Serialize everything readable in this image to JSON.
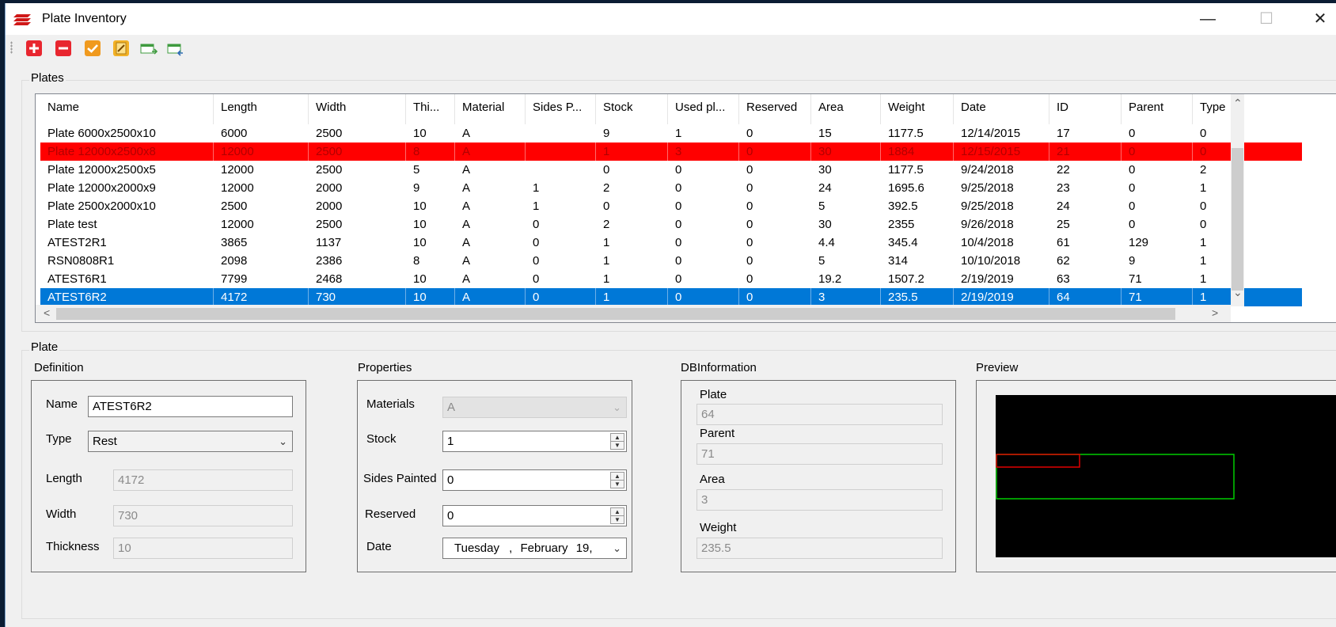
{
  "window": {
    "title": "Plate Inventory",
    "controls": {
      "minimize": "—",
      "maximize": "☐",
      "close": "✕"
    }
  },
  "toolbar": {
    "buttons": [
      {
        "name": "add-plate",
        "icon": "plus-icon",
        "color": "#e8262f"
      },
      {
        "name": "remove-plate",
        "icon": "minus-icon",
        "color": "#e8262f"
      },
      {
        "name": "apply",
        "icon": "check-icon",
        "color": "#f09a1f"
      },
      {
        "name": "edit",
        "icon": "pencil-icon",
        "color": "#f2b126"
      },
      {
        "name": "export-csv",
        "icon": "csv-export-icon",
        "color": "#3f9b3f"
      },
      {
        "name": "import-csv",
        "icon": "csv-import-icon",
        "color": "#3f9b3f"
      }
    ]
  },
  "plates": {
    "label": "Plates",
    "columns": [
      "Name",
      "Length",
      "Width",
      "Thi...",
      "Material",
      "Sides P...",
      "Stock",
      "Used pl...",
      "Reserved",
      "Area",
      "Weight",
      "Date",
      "ID",
      "Parent",
      "Type"
    ],
    "rows": [
      {
        "state": "normal",
        "cells": [
          "Plate 6000x2500x10",
          "6000",
          "2500",
          "10",
          "A",
          "",
          "9",
          "1",
          "0",
          "15",
          "1177.5",
          "12/14/2015",
          "17",
          "0",
          "0"
        ]
      },
      {
        "state": "red",
        "cells": [
          "Plate 12000x2500x8",
          "12000",
          "2500",
          "8",
          "A",
          "",
          "1",
          "3",
          "0",
          "30",
          "1884",
          "12/15/2015",
          "21",
          "0",
          "0"
        ]
      },
      {
        "state": "normal",
        "cells": [
          "Plate 12000x2500x5",
          "12000",
          "2500",
          "5",
          "A",
          "",
          "0",
          "0",
          "0",
          "30",
          "1177.5",
          "9/24/2018",
          "22",
          "0",
          "2"
        ]
      },
      {
        "state": "normal",
        "cells": [
          "Plate 12000x2000x9",
          "12000",
          "2000",
          "9",
          "A",
          "1",
          "2",
          "0",
          "0",
          "24",
          "1695.6",
          "9/25/2018",
          "23",
          "0",
          "1"
        ]
      },
      {
        "state": "normal",
        "cells": [
          "Plate 2500x2000x10",
          "2500",
          "2000",
          "10",
          "A",
          "1",
          "0",
          "0",
          "0",
          "5",
          "392.5",
          "9/25/2018",
          "24",
          "0",
          "0"
        ]
      },
      {
        "state": "normal",
        "cells": [
          "Plate test",
          "12000",
          "2500",
          "10",
          "A",
          "0",
          "2",
          "0",
          "0",
          "30",
          "2355",
          "9/26/2018",
          "25",
          "0",
          "0"
        ]
      },
      {
        "state": "normal",
        "cells": [
          "ATEST2R1",
          "3865",
          "1137",
          "10",
          "A",
          "0",
          "1",
          "0",
          "0",
          "4.4",
          "345.4",
          "10/4/2018",
          "61",
          "129",
          "1"
        ]
      },
      {
        "state": "normal",
        "cells": [
          "RSN0808R1",
          "2098",
          "2386",
          "8",
          "A",
          "0",
          "1",
          "0",
          "0",
          "5",
          "314",
          "10/10/2018",
          "62",
          "9",
          "1"
        ]
      },
      {
        "state": "normal",
        "cells": [
          "ATEST6R1",
          "7799",
          "2468",
          "10",
          "A",
          "0",
          "1",
          "0",
          "0",
          "19.2",
          "1507.2",
          "2/19/2019",
          "63",
          "71",
          "1"
        ]
      },
      {
        "state": "selected",
        "cells": [
          "ATEST6R2",
          "4172",
          "730",
          "10",
          "A",
          "0",
          "1",
          "0",
          "0",
          "3",
          "235.5",
          "2/19/2019",
          "64",
          "71",
          "1"
        ]
      }
    ],
    "row_colors": {
      "red": "#ff0000",
      "selected": "#0078d7"
    }
  },
  "plate": {
    "label": "Plate",
    "definition": {
      "label": "Definition",
      "name_label": "Name",
      "name_value": "ATEST6R2",
      "type_label": "Type",
      "type_value": "Rest",
      "length_label": "Length",
      "length_value": "4172",
      "width_label": "Width",
      "width_value": "730",
      "thickness_label": "Thickness",
      "thickness_value": "10"
    },
    "properties": {
      "label": "Properties",
      "materials_label": "Materials",
      "materials_value": "A",
      "stock_label": "Stock",
      "stock_value": "1",
      "sides_painted_label": "Sides Painted",
      "sides_painted_value": "0",
      "reserved_label": "Reserved",
      "reserved_value": "0",
      "date_label": "Date",
      "date_day": "Tuesday",
      "date_sep": ",",
      "date_month": "February",
      "date_num": "19,"
    },
    "dbinformation": {
      "label": "DBInformation",
      "plate_label": "Plate",
      "plate_value": "64",
      "parent_label": "Parent",
      "parent_value": "71",
      "area_label": "Area",
      "area_value": "3",
      "weight_label": "Weight",
      "weight_value": "235.5"
    },
    "preview": {
      "label": "Preview",
      "colors": {
        "background": "#000000",
        "plate_outline": "#00cc00",
        "remnant_outline": "#e00000"
      }
    }
  }
}
